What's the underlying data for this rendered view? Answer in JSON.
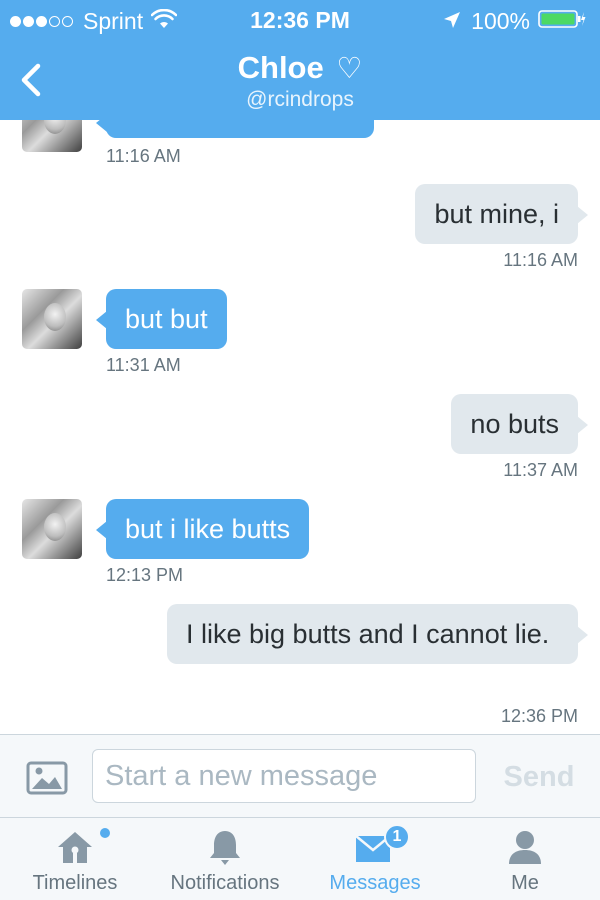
{
  "status_bar": {
    "carrier": "Sprint",
    "time": "12:36 PM",
    "battery": "100%"
  },
  "header": {
    "name": "Chloe",
    "heart": "♡",
    "handle": "@rcindrops"
  },
  "thread": {
    "top_timestamp": "11:16 AM",
    "messages": [
      {
        "direction": "out",
        "text": "but mine, i",
        "timestamp": "11:16 AM"
      },
      {
        "direction": "in",
        "text": "but but",
        "timestamp": "11:31 AM"
      },
      {
        "direction": "out",
        "text": "no buts",
        "timestamp": "11:37 AM"
      },
      {
        "direction": "in",
        "text": "but i like butts",
        "timestamp": "12:13 PM"
      },
      {
        "direction": "out",
        "text": "I like big butts and I cannot lie.",
        "timestamp": "12:36 PM"
      }
    ]
  },
  "composer": {
    "placeholder": "Start a new message",
    "send_label": "Send"
  },
  "tabs": [
    {
      "label": "Timelines",
      "icon": "home-icon"
    },
    {
      "label": "Notifications",
      "icon": "bell-icon"
    },
    {
      "label": "Messages",
      "icon": "envelope-icon",
      "badge": "1",
      "active": true
    },
    {
      "label": "Me",
      "icon": "person-icon"
    }
  ],
  "colors": {
    "accent": "#55acee",
    "bubble_out": "#e1e8ed",
    "muted_text": "#66757f"
  }
}
